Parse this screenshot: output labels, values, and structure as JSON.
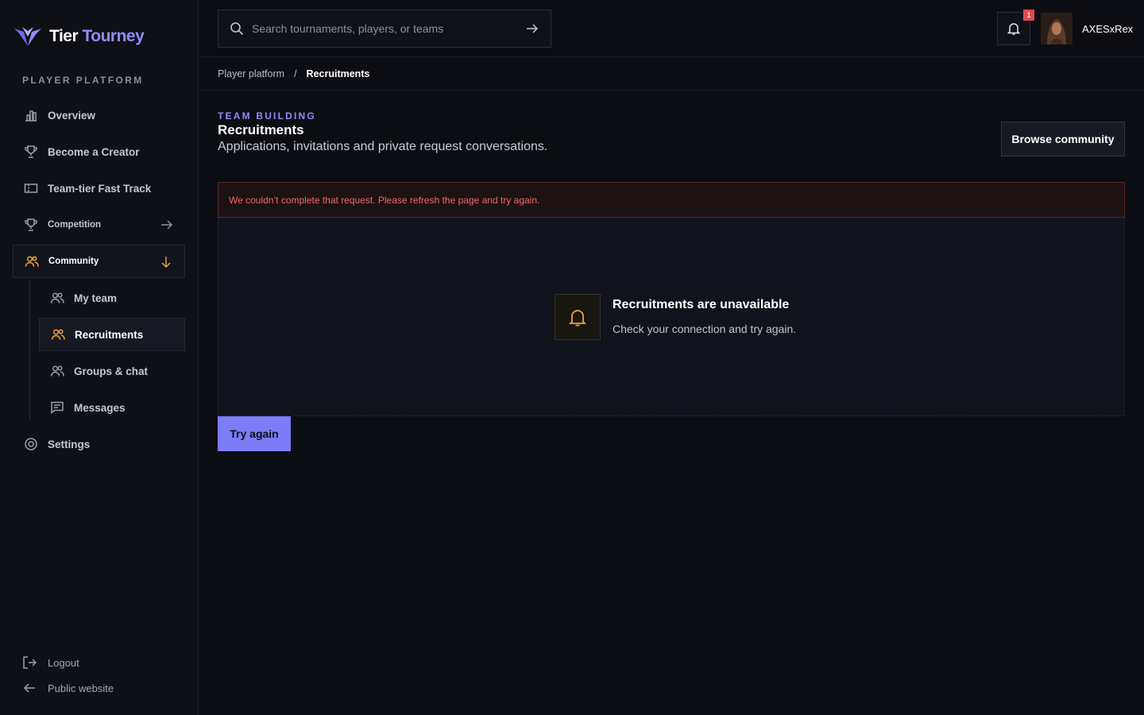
{
  "brand": {
    "name_part1": "Tier",
    "name_part2": "Tourney"
  },
  "sidebar": {
    "section_label": "PLAYER PLATFORM",
    "items": [
      {
        "label": "Overview",
        "icon": "bar-chart-icon"
      },
      {
        "label": "Become a Creator",
        "icon": "trophy-icon"
      },
      {
        "label": "Team-tier Fast Track",
        "icon": "ticket-icon"
      },
      {
        "label": "Competition",
        "icon": "trophy-icon"
      },
      {
        "label": "Community",
        "icon": "users-icon"
      },
      {
        "label": "Settings",
        "icon": "gear-icon"
      }
    ],
    "sub_items": [
      {
        "label": "My team",
        "icon": "users-icon"
      },
      {
        "label": "Recruitments",
        "icon": "users-icon"
      },
      {
        "label": "Groups & chat",
        "icon": "users-icon"
      },
      {
        "label": "Messages",
        "icon": "message-icon"
      }
    ],
    "footer": [
      {
        "label": "Logout",
        "icon": "logout-icon"
      },
      {
        "label": "Public website",
        "icon": "arrow-left-icon"
      }
    ]
  },
  "topbar": {
    "search_placeholder": "Search tournaments, players, or teams",
    "notification_count": "1",
    "username": "AXESxRex"
  },
  "breadcrumb": {
    "parent": "Player platform",
    "separator": "/",
    "current": "Recruitments"
  },
  "header": {
    "eyebrow": "TEAM BUILDING",
    "title": "Recruitments",
    "subtitle": "Applications, invitations and private request conversations.",
    "action_label": "Browse community"
  },
  "error": {
    "message": "We couldn’t complete that request. Please refresh the page and try again."
  },
  "empty_state": {
    "title": "Recruitments are unavailable",
    "description": "Check your connection and try again.",
    "icon": "bell-icon"
  },
  "retry_label": "Try again",
  "colors": {
    "accent": "#8f8cff",
    "warning": "#f0a23a",
    "error": "#f26b6b",
    "background": "#0b0d12"
  }
}
